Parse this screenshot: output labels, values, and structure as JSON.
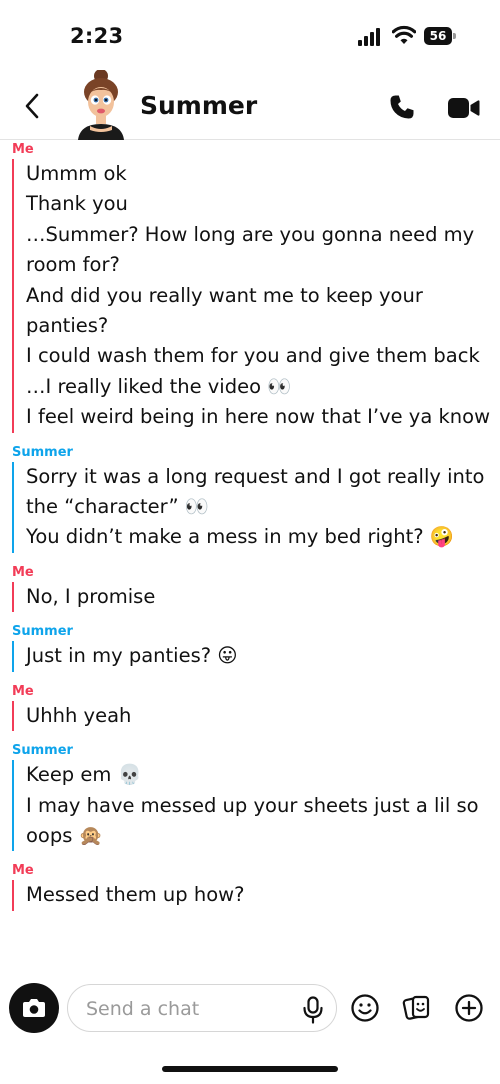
{
  "status_bar": {
    "time": "2:23",
    "battery": "56"
  },
  "header": {
    "contact_name": "Summer",
    "avatar_icon": "bitmoji-avatar"
  },
  "colors": {
    "me": "#f23c57",
    "summer": "#0ea4eb"
  },
  "messages": [
    {
      "sender": "Me",
      "from": "me",
      "lines": [
        "Ummm ok",
        "Thank you",
        "…Summer? How long are you gonna need my room for?",
        "And did you really want me to keep your panties?",
        "I could wash them for you and give them back",
        "…I really liked the video 👀",
        "I feel weird being in here now that I’ve ya know"
      ]
    },
    {
      "sender": "Summer",
      "from": "summer",
      "lines": [
        "Sorry it was a long request and I got really into the “character” 👀",
        "You didn’t make a mess in my bed right? 🤪"
      ]
    },
    {
      "sender": "Me",
      "from": "me",
      "lines": [
        "No, I promise"
      ]
    },
    {
      "sender": "Summer",
      "from": "summer",
      "lines": [
        "Just in my panties? 😛"
      ]
    },
    {
      "sender": "Me",
      "from": "me",
      "lines": [
        "Uhhh yeah"
      ]
    },
    {
      "sender": "Summer",
      "from": "summer",
      "lines": [
        "Keep em 💀",
        "I may have messed up your sheets just a lil so oops 🙊"
      ]
    },
    {
      "sender": "Me",
      "from": "me",
      "lines": [
        "Messed them up how?"
      ]
    }
  ],
  "input": {
    "placeholder": "Send a chat"
  }
}
